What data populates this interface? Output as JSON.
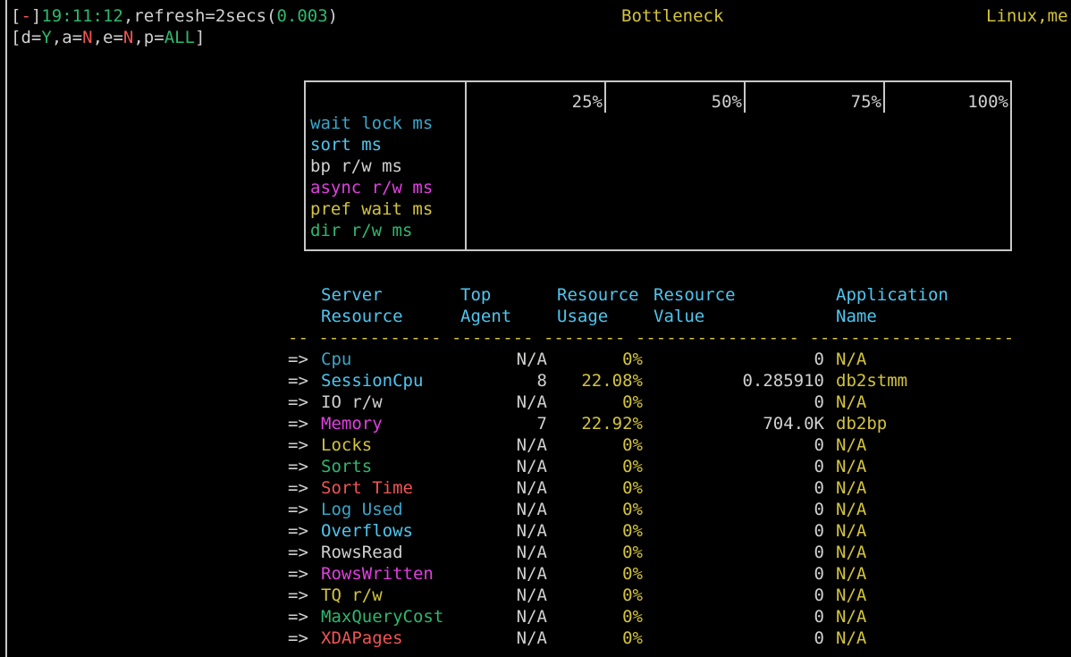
{
  "status": {
    "bracket_open": "[",
    "toggle": "-",
    "bracket_close": "]",
    "time": "19:11:12",
    "refresh_label": ",refresh=",
    "refresh_value": "2secs(",
    "refresh_latency": "0.003",
    "refresh_close": ")",
    "view_title": "Bottleneck",
    "host_info": "Linux,me"
  },
  "options": {
    "open": "[",
    "d_label": "d=",
    "d_value": "Y",
    "a_label": ",a=",
    "a_value": "N",
    "e_label": ",e=",
    "e_value": "N",
    "p_label": ",p=",
    "p_value": "ALL",
    "close": "]"
  },
  "chart_data": {
    "type": "bar",
    "orientation": "horizontal",
    "categories": [
      "wait lock ms",
      "sort ms",
      "bp r/w ms",
      "async r/w ms",
      "pref wait ms",
      "dir r/w ms"
    ],
    "values": [
      0,
      0,
      0,
      0,
      0,
      0
    ],
    "ticks": [
      "25%",
      "50%",
      "75%",
      "100%"
    ],
    "xlim": [
      0,
      100
    ],
    "category_colors": [
      "#3aa6c8",
      "#4fc6f0",
      "#d0d0d0",
      "#e040e0",
      "#d4c43c",
      "#2fb86e"
    ]
  },
  "table": {
    "headers": {
      "res_1": "Server",
      "res_2": "Resource",
      "agent_1": "Top",
      "agent_2": "Agent",
      "usage_1": "Resource",
      "usage_2": "Usage",
      "value_1": "Resource",
      "value_2": "Value",
      "app_1": "Application",
      "app_2": "Name"
    },
    "separator": "-- ------------ -------- -------- ---------------- --------------------",
    "rows": [
      {
        "arrow": "=>",
        "resource": "Cpu",
        "color": "#3aa6c8",
        "agent": "N/A",
        "usage": "0%",
        "value": "0",
        "app": "N/A"
      },
      {
        "arrow": "=>",
        "resource": "SessionCpu",
        "color": "#4fc6f0",
        "agent": "8",
        "usage": "22.08%",
        "value": "0.285910",
        "app": "db2stmm"
      },
      {
        "arrow": "=>",
        "resource": "IO r/w",
        "color": "#d0d0d0",
        "agent": "N/A",
        "usage": "0%",
        "value": "0",
        "app": "N/A"
      },
      {
        "arrow": "=>",
        "resource": "Memory",
        "color": "#e040e0",
        "agent": "7",
        "usage": "22.92%",
        "value": "704.0K",
        "app": "db2bp"
      },
      {
        "arrow": "=>",
        "resource": "Locks",
        "color": "#d4c43c",
        "agent": "N/A",
        "usage": "0%",
        "value": "0",
        "app": "N/A"
      },
      {
        "arrow": "=>",
        "resource": "Sorts",
        "color": "#2fb86e",
        "agent": "N/A",
        "usage": "0%",
        "value": "0",
        "app": "N/A"
      },
      {
        "arrow": "=>",
        "resource": "Sort Time",
        "color": "#f05555",
        "agent": "N/A",
        "usage": "0%",
        "value": "0",
        "app": "N/A"
      },
      {
        "arrow": "=>",
        "resource": "Log Used",
        "color": "#3aa6c8",
        "agent": "N/A",
        "usage": "0%",
        "value": "0",
        "app": "N/A"
      },
      {
        "arrow": "=>",
        "resource": "Overflows",
        "color": "#4fc6f0",
        "agent": "N/A",
        "usage": "0%",
        "value": "0",
        "app": "N/A"
      },
      {
        "arrow": "=>",
        "resource": "RowsRead",
        "color": "#d0d0d0",
        "agent": "N/A",
        "usage": "0%",
        "value": "0",
        "app": "N/A"
      },
      {
        "arrow": "=>",
        "resource": "RowsWritten",
        "color": "#e040e0",
        "agent": "N/A",
        "usage": "0%",
        "value": "0",
        "app": "N/A"
      },
      {
        "arrow": "=>",
        "resource": "TQ r/w",
        "color": "#d4c43c",
        "agent": "N/A",
        "usage": "0%",
        "value": "0",
        "app": "N/A"
      },
      {
        "arrow": "=>",
        "resource": "MaxQueryCost",
        "color": "#2fb86e",
        "agent": "N/A",
        "usage": "0%",
        "value": "0",
        "app": "N/A"
      },
      {
        "arrow": "=>",
        "resource": "XDAPages",
        "color": "#f05555",
        "agent": "N/A",
        "usage": "0%",
        "value": "0",
        "app": "N/A"
      }
    ]
  },
  "colors": {
    "green": "#2fb86e",
    "red": "#f05555",
    "yellow": "#d4c43c",
    "cyan": "#4fc6f0",
    "fg": "#d0d0d0"
  }
}
